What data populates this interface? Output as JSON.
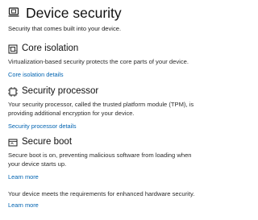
{
  "header": {
    "title": "Device security",
    "subtitle": "Security that comes built into your device.",
    "icon": "laptop-shield-icon"
  },
  "sections": [
    {
      "title": "Core isolation",
      "icon": "chip-icon",
      "description": "Virtualization-based security protects the core parts of your device.",
      "link": "Core isolation details"
    },
    {
      "title": "Security processor",
      "icon": "processor-icon",
      "description": "Your security processor, called the trusted platform module (TPM), is providing additional encryption for your device.",
      "link": "Security processor details"
    },
    {
      "title": "Secure boot",
      "icon": "boot-icon",
      "description": "Secure boot is on, preventing malicious software from loading when your device starts up.",
      "link": "Learn more"
    }
  ],
  "hardware": {
    "text": "Your device meets the requirements for enhanced hardware security.",
    "link": "Learn more"
  },
  "colors": {
    "link": "#0063b1",
    "text": "#1b1b1b"
  }
}
